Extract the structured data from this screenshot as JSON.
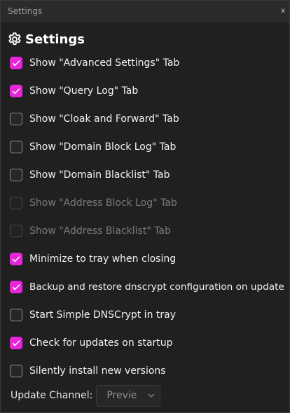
{
  "window": {
    "title": "Settings",
    "close_label": "x"
  },
  "header": {
    "icon": "gear-icon",
    "title": "Settings"
  },
  "accent_color": "#e626d9",
  "options": [
    {
      "label": "Show \"Advanced Settings\" Tab",
      "checked": true,
      "enabled": true
    },
    {
      "label": "Show \"Query Log\" Tab",
      "checked": true,
      "enabled": true
    },
    {
      "label": "Show \"Cloak and Forward\" Tab",
      "checked": false,
      "enabled": true
    },
    {
      "label": "Show \"Domain Block Log\" Tab",
      "checked": false,
      "enabled": true
    },
    {
      "label": "Show \"Domain Blacklist\" Tab",
      "checked": false,
      "enabled": true
    },
    {
      "label": "Show \"Address Block Log\" Tab",
      "checked": false,
      "enabled": false
    },
    {
      "label": "Show \"Address Blacklist\" Tab",
      "checked": false,
      "enabled": false
    },
    {
      "label": "Minimize to tray when closing",
      "checked": true,
      "enabled": true
    },
    {
      "label": "Backup and restore dnscrypt configuration on update",
      "checked": true,
      "enabled": true
    },
    {
      "label": "Start Simple DNSCrypt in tray",
      "checked": false,
      "enabled": true
    },
    {
      "label": "Check for updates on startup",
      "checked": true,
      "enabled": true
    },
    {
      "label": "Silently install new versions",
      "checked": false,
      "enabled": true
    }
  ],
  "update_channel": {
    "label": "Update Channel:",
    "value": "Previe"
  }
}
